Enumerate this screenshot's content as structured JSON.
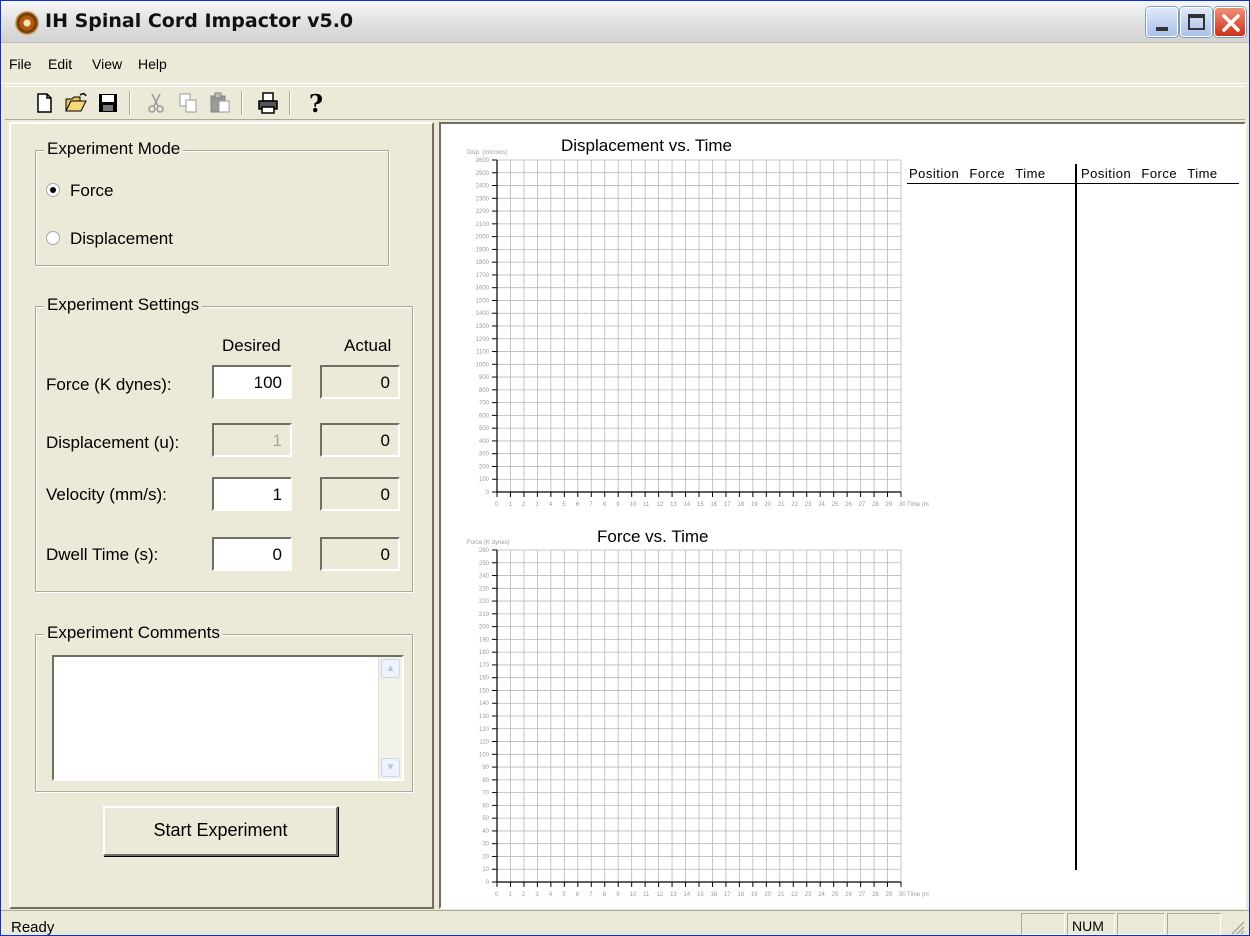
{
  "window": {
    "title": "IH Spinal Cord Impactor v5.0"
  },
  "menu": {
    "items": [
      "File",
      "Edit",
      "View",
      "Help"
    ]
  },
  "toolbar": {
    "buttons": [
      "new-icon",
      "open-icon",
      "save-icon",
      "cut-icon",
      "copy-icon",
      "paste-icon",
      "print-icon",
      "help-icon"
    ]
  },
  "experiment_mode": {
    "title": "Experiment Mode",
    "options": [
      {
        "label": "Force",
        "selected": true
      },
      {
        "label": "Displacement",
        "selected": false
      }
    ]
  },
  "settings": {
    "title": "Experiment Settings",
    "col_desired": "Desired",
    "col_actual": "Actual",
    "rows": [
      {
        "label": "Force (K dynes):",
        "desired": "100",
        "actual": "0",
        "desired_enabled": true
      },
      {
        "label": "Displacement (u):",
        "desired": "1",
        "actual": "0",
        "desired_enabled": false
      },
      {
        "label": "Velocity (mm/s):",
        "desired": "1",
        "actual": "0",
        "desired_enabled": true
      },
      {
        "label": "Dwell Time (s):",
        "desired": "0",
        "actual": "0",
        "desired_enabled": true
      }
    ]
  },
  "comments": {
    "title": "Experiment Comments",
    "value": ""
  },
  "start_button": {
    "label": "Start Experiment"
  },
  "charts": {
    "displacement": {
      "title": "Displacement vs. Time",
      "ylabel": "Disp. (microns)",
      "xlabel": "Time (ms)"
    },
    "force": {
      "title": "Force vs. Time",
      "ylabel": "Force (K dynes)",
      "xlabel": "Time (ms)"
    }
  },
  "chart_data": [
    {
      "type": "line",
      "title": "Displacement vs. Time",
      "ylabel": "Disp. (microns)",
      "xlabel": "Time (ms)",
      "xlim": [
        0,
        30
      ],
      "ylim": [
        0,
        2600
      ],
      "ystep": 100,
      "xstep": 1,
      "grid": true,
      "series": []
    },
    {
      "type": "line",
      "title": "Force vs. Time",
      "ylabel": "Force (K dynes)",
      "xlabel": "Time (ms)",
      "xlim": [
        0,
        30
      ],
      "ylim": [
        0,
        260
      ],
      "ystep": 10,
      "xstep": 1,
      "grid": true,
      "series": []
    }
  ],
  "data_table": {
    "headers": [
      "Position",
      "Force",
      "Time",
      "Position",
      "Force",
      "Time"
    ]
  },
  "status": {
    "text": "Ready",
    "num": "NUM"
  },
  "colors": {
    "grid": "#b8b8b8",
    "text_light": "#9a9a9a"
  }
}
